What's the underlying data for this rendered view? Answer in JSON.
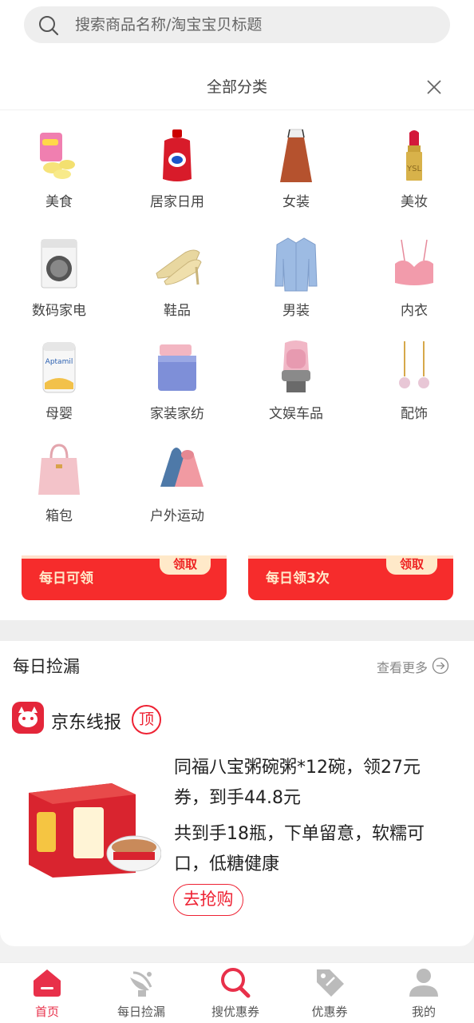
{
  "search": {
    "placeholder": "搜索商品名称/淘宝宝贝标题"
  },
  "category_panel": {
    "title": "全部分类",
    "items": [
      {
        "label": "美食",
        "icon": "snack-icon"
      },
      {
        "label": "居家日用",
        "icon": "detergent-icon"
      },
      {
        "label": "女装",
        "icon": "dress-icon"
      },
      {
        "label": "美妆",
        "icon": "lipstick-icon"
      },
      {
        "label": "数码家电",
        "icon": "washing-machine-icon"
      },
      {
        "label": "鞋品",
        "icon": "heels-icon"
      },
      {
        "label": "男装",
        "icon": "shirt-icon"
      },
      {
        "label": "内衣",
        "icon": "bra-icon"
      },
      {
        "label": "母婴",
        "icon": "milk-powder-icon"
      },
      {
        "label": "家装家纺",
        "icon": "bedding-icon"
      },
      {
        "label": "文娱车品",
        "icon": "car-seat-icon"
      },
      {
        "label": "配饰",
        "icon": "earrings-icon"
      },
      {
        "label": "箱包",
        "icon": "handbag-icon"
      },
      {
        "label": "户外运动",
        "icon": "yoga-mat-icon"
      }
    ]
  },
  "coupons": [
    {
      "subtitle": "每日可领",
      "button": "领取"
    },
    {
      "subtitle": "每日领3次",
      "button": "领取"
    }
  ],
  "daily": {
    "title": "每日捡漏",
    "more": "查看更多",
    "card": {
      "source": "京东线报",
      "badge": "顶",
      "title": "同福八宝粥碗粥*12碗，领27元券，到手44.8元",
      "desc": "共到手18瓶，下单留意，软糯可口，低糖健康",
      "button": "去抢购"
    }
  },
  "bottom_nav": {
    "items": [
      {
        "label": "首页",
        "icon": "home-icon",
        "active": true
      },
      {
        "label": "每日捡漏",
        "icon": "radar-icon",
        "active": false
      },
      {
        "label": "搜优惠券",
        "icon": "search-coupon-icon",
        "active": false
      },
      {
        "label": "优惠券",
        "icon": "coupon-tag-icon",
        "active": false
      },
      {
        "label": "我的",
        "icon": "user-icon",
        "active": false
      }
    ]
  },
  "colors": {
    "accent": "#e8304a",
    "coupon_red": "#f62c2c"
  }
}
